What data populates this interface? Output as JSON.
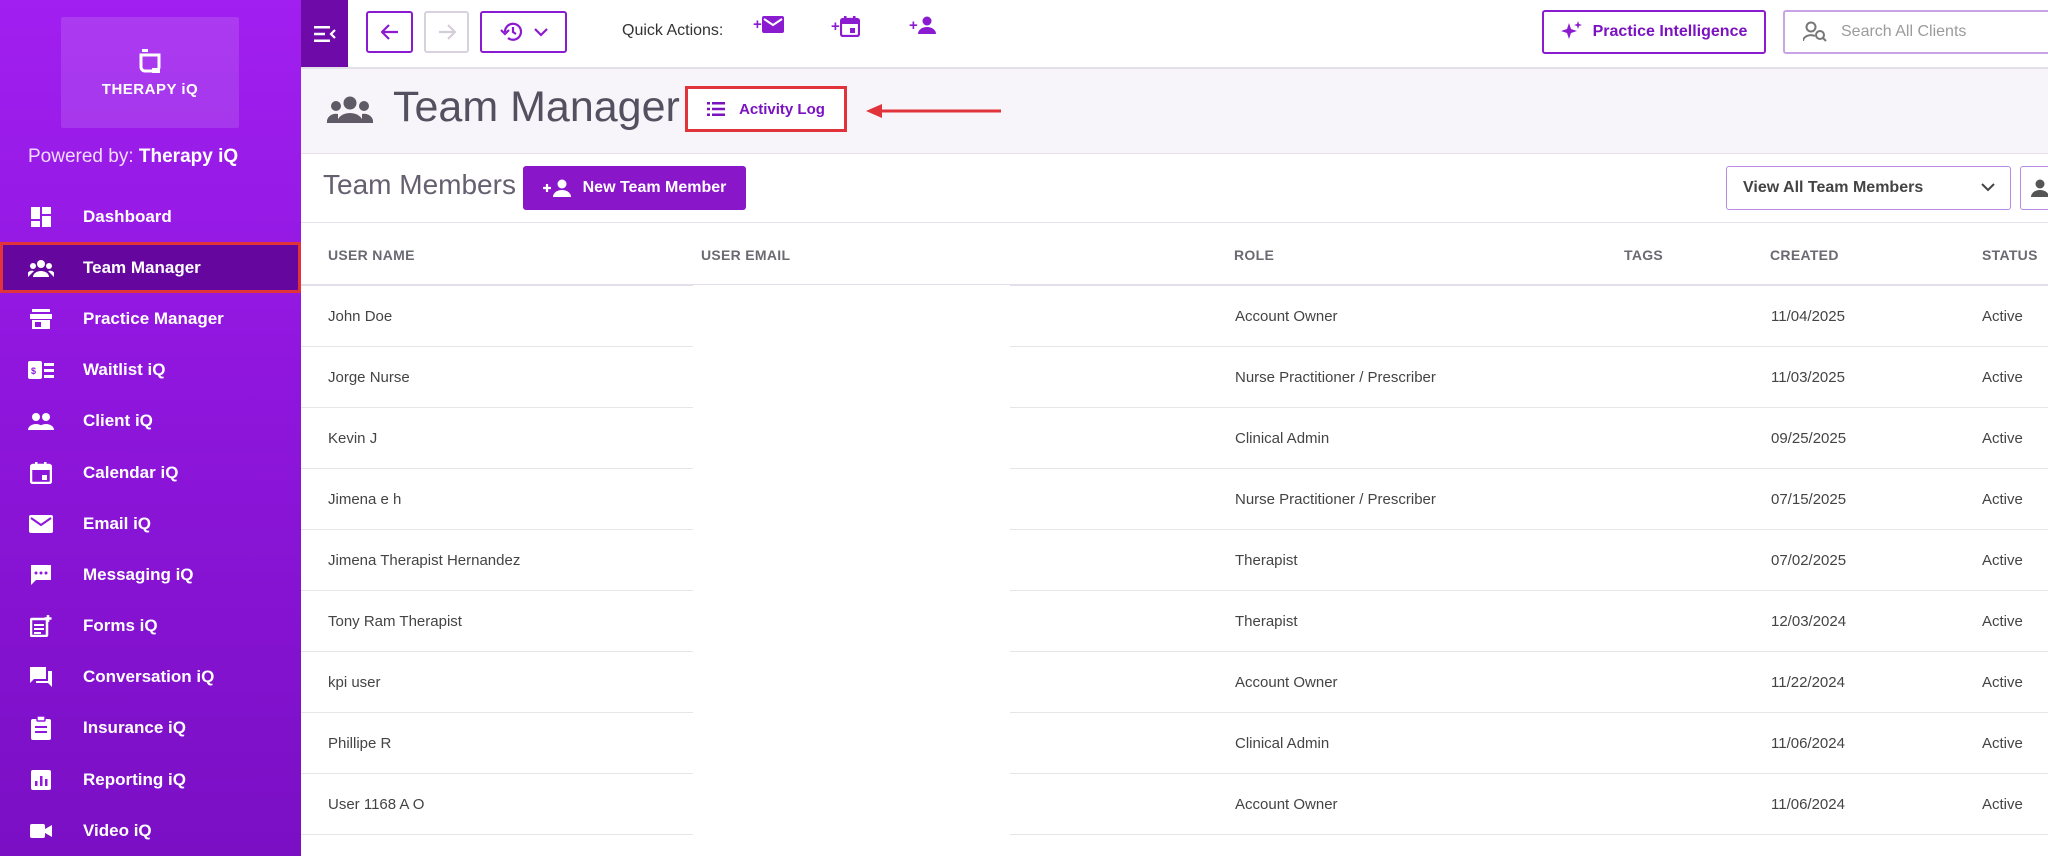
{
  "sidebar": {
    "logo_text": "THERAPY iQ",
    "powered_prefix": "Powered by: ",
    "powered_brand": "Therapy iQ",
    "items": [
      {
        "label": "Dashboard",
        "icon": "dashboard-icon"
      },
      {
        "label": "Team Manager",
        "icon": "team-icon",
        "active": true
      },
      {
        "label": "Practice Manager",
        "icon": "store-icon"
      },
      {
        "label": "Waitlist iQ",
        "icon": "waitlist-icon"
      },
      {
        "label": "Client iQ",
        "icon": "clients-icon"
      },
      {
        "label": "Calendar iQ",
        "icon": "calendar-icon"
      },
      {
        "label": "Email iQ",
        "icon": "email-icon"
      },
      {
        "label": "Messaging iQ",
        "icon": "message-icon"
      },
      {
        "label": "Forms iQ",
        "icon": "forms-icon"
      },
      {
        "label": "Conversation iQ",
        "icon": "conversation-icon"
      },
      {
        "label": "Insurance iQ",
        "icon": "insurance-icon"
      },
      {
        "label": "Reporting iQ",
        "icon": "reporting-icon"
      },
      {
        "label": "Video iQ",
        "icon": "video-icon"
      }
    ]
  },
  "topbar": {
    "quick_actions_label": "Quick Actions:",
    "practice_intelligence": "Practice Intelligence",
    "search_placeholder": "Search All Clients"
  },
  "page": {
    "title": "Team Manager",
    "activity_log": "Activity Log"
  },
  "section": {
    "title": "Team Members",
    "new_member": "New Team Member",
    "view_select": "View All Team Members"
  },
  "table": {
    "headers": [
      "USER NAME",
      "USER EMAIL",
      "ROLE",
      "TAGS",
      "CREATED",
      "STATUS"
    ],
    "rows": [
      {
        "name": "John Doe",
        "role": "Account Owner",
        "created": "11/04/2025",
        "status": "Active"
      },
      {
        "name": "Jorge Nurse",
        "role": "Nurse Practitioner / Prescriber",
        "created": "11/03/2025",
        "status": "Active"
      },
      {
        "name": "Kevin J",
        "role": "Clinical Admin",
        "created": "09/25/2025",
        "status": "Active"
      },
      {
        "name": "Jimena e h",
        "role": "Nurse Practitioner / Prescriber",
        "created": "07/15/2025",
        "status": "Active"
      },
      {
        "name": "Jimena Therapist Hernandez",
        "role": "Therapist",
        "created": "07/02/2025",
        "status": "Active"
      },
      {
        "name": "Tony Ram Therapist",
        "role": "Therapist",
        "created": "12/03/2024",
        "status": "Active"
      },
      {
        "name": "kpi user",
        "role": "Account Owner",
        "created": "11/22/2024",
        "status": "Active"
      },
      {
        "name": "Phillipe R",
        "role": "Clinical Admin",
        "created": "11/06/2024",
        "status": "Active"
      },
      {
        "name": "User 1168 A O",
        "role": "Account Owner",
        "created": "11/06/2024",
        "status": "Active"
      }
    ]
  },
  "colors": {
    "brand_purple": "#8a16c9",
    "sidebar_active": "#65079f",
    "highlight_red": "#e0343a"
  }
}
